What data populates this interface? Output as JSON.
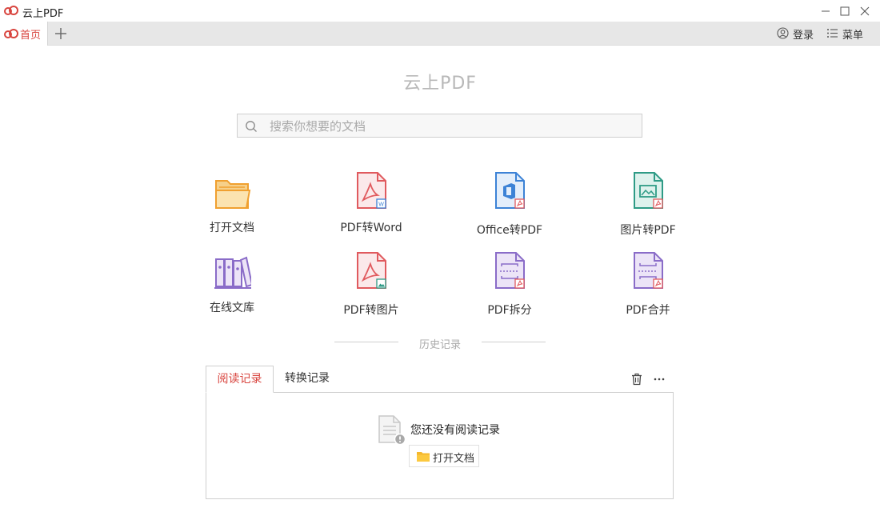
{
  "window": {
    "title": "云上PDF",
    "logo_icon": "cloud-logo-icon",
    "controls": [
      "minimize-icon",
      "maximize-icon",
      "close-icon"
    ]
  },
  "tabs": {
    "home_label": "首页",
    "add_icon": "plus-icon"
  },
  "header": {
    "login_label": "登录",
    "menu_label": "菜单"
  },
  "main": {
    "app_name": "云上PDF",
    "search_placeholder": "搜索你想要的文档",
    "tools": [
      {
        "label": "打开文档",
        "icon": "folder-icon"
      },
      {
        "label": "PDF转Word",
        "icon": "pdf-to-word-icon"
      },
      {
        "label": "Office转PDF",
        "icon": "office-to-pdf-icon"
      },
      {
        "label": "图片转PDF",
        "icon": "image-to-pdf-icon"
      },
      {
        "label": "在线文库",
        "icon": "library-books-icon"
      },
      {
        "label": "PDF转图片",
        "icon": "pdf-to-image-icon"
      },
      {
        "label": "PDF拆分",
        "icon": "pdf-split-icon"
      },
      {
        "label": "PDF合并",
        "icon": "pdf-merge-icon"
      }
    ]
  },
  "history": {
    "title": "历史记录",
    "tabs": [
      {
        "label": "阅读记录",
        "active": true
      },
      {
        "label": "转换记录",
        "active": false
      }
    ],
    "empty_text": "您还没有阅读记录",
    "open_button_label": "打开文档"
  },
  "colors": {
    "brand_red": "#d8443e",
    "folder_orange": "#f0a030",
    "pdf_red": "#e05a5e",
    "office_blue": "#3c82d6",
    "image_teal": "#2e9b86",
    "purple": "#8a6cc8"
  }
}
